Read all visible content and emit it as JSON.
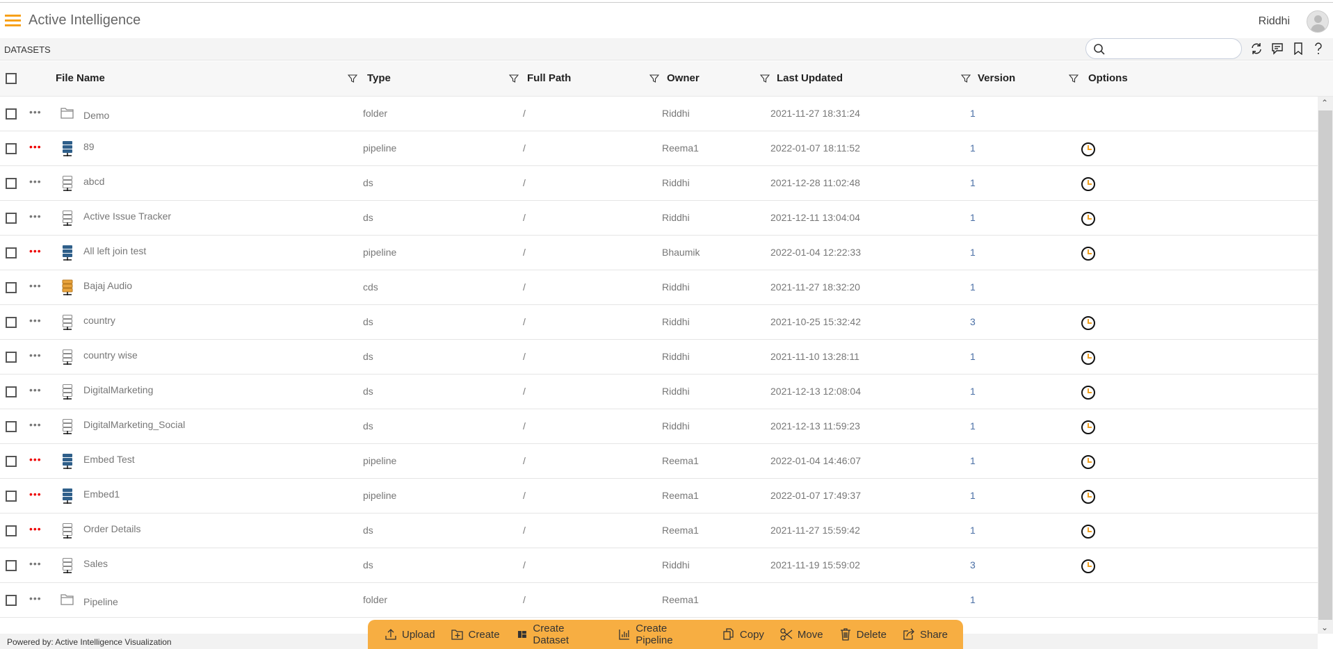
{
  "app": {
    "title": "Active Intelligence",
    "user": "Riddhi"
  },
  "section": {
    "title": "DATASETS",
    "search_placeholder": ""
  },
  "columns": [
    "File Name",
    "Type",
    "Full Path",
    "Owner",
    "Last Updated",
    "Version",
    "Options"
  ],
  "rows": [
    {
      "name": "Demo",
      "icon": "folder",
      "type": "folder",
      "path": "/",
      "owner": "Riddhi",
      "updated": "2021-11-27 18:31:24",
      "version": "1",
      "clock": false,
      "dots_red": false
    },
    {
      "name": "89",
      "icon": "pipeline",
      "type": "pipeline",
      "path": "/",
      "owner": "Reema1",
      "updated": "2022-01-07 18:11:52",
      "version": "1",
      "clock": true,
      "dots_red": true
    },
    {
      "name": "abcd",
      "icon": "ds",
      "type": "ds",
      "path": "/",
      "owner": "Riddhi",
      "updated": "2021-12-28 11:02:48",
      "version": "1",
      "clock": true,
      "dots_red": false
    },
    {
      "name": "Active Issue Tracker",
      "icon": "ds",
      "type": "ds",
      "path": "/",
      "owner": "Riddhi",
      "updated": "2021-12-11 13:04:04",
      "version": "1",
      "clock": true,
      "dots_red": false
    },
    {
      "name": "All left join test",
      "icon": "pipeline",
      "type": "pipeline",
      "path": "/",
      "owner": "Bhaumik",
      "updated": "2022-01-04 12:22:33",
      "version": "1",
      "clock": true,
      "dots_red": true
    },
    {
      "name": "Bajaj Audio",
      "icon": "cds",
      "type": "cds",
      "path": "/",
      "owner": "Riddhi",
      "updated": "2021-11-27 18:32:20",
      "version": "1",
      "clock": false,
      "dots_red": false
    },
    {
      "name": "country",
      "icon": "ds",
      "type": "ds",
      "path": "/",
      "owner": "Riddhi",
      "updated": "2021-10-25 15:32:42",
      "version": "3",
      "clock": true,
      "dots_red": false
    },
    {
      "name": "country wise",
      "icon": "ds",
      "type": "ds",
      "path": "/",
      "owner": "Riddhi",
      "updated": "2021-11-10 13:28:11",
      "version": "1",
      "clock": true,
      "dots_red": false
    },
    {
      "name": "DigitalMarketing",
      "icon": "ds",
      "type": "ds",
      "path": "/",
      "owner": "Riddhi",
      "updated": "2021-12-13 12:08:04",
      "version": "1",
      "clock": true,
      "dots_red": false
    },
    {
      "name": "DigitalMarketing_Social",
      "icon": "ds",
      "type": "ds",
      "path": "/",
      "owner": "Riddhi",
      "updated": "2021-12-13 11:59:23",
      "version": "1",
      "clock": true,
      "dots_red": false
    },
    {
      "name": "Embed Test",
      "icon": "pipeline",
      "type": "pipeline",
      "path": "/",
      "owner": "Reema1",
      "updated": "2022-01-04 14:46:07",
      "version": "1",
      "clock": true,
      "dots_red": true
    },
    {
      "name": "Embed1",
      "icon": "pipeline",
      "type": "pipeline",
      "path": "/",
      "owner": "Reema1",
      "updated": "2022-01-07 17:49:37",
      "version": "1",
      "clock": true,
      "dots_red": true
    },
    {
      "name": "Order Details",
      "icon": "ds",
      "type": "ds",
      "path": "/",
      "owner": "Reema1",
      "updated": "2021-11-27 15:59:42",
      "version": "1",
      "clock": true,
      "dots_red": true
    },
    {
      "name": "Sales",
      "icon": "ds",
      "type": "ds",
      "path": "/",
      "owner": "Riddhi",
      "updated": "2021-11-19 15:59:02",
      "version": "3",
      "clock": true,
      "dots_red": false
    },
    {
      "name": "Pipeline",
      "icon": "folder",
      "type": "folder",
      "path": "/",
      "owner": "Reema1",
      "updated": "",
      "version": "1",
      "clock": false,
      "dots_red": false
    }
  ],
  "toolbar": [
    "Upload",
    "Create",
    "Create Dataset",
    "Create Pipeline",
    "Copy",
    "Move",
    "Delete",
    "Share"
  ],
  "footer": "Powered by: Active Intelligence Visualization",
  "colors": {
    "accent": "#f7a11a",
    "toolbar": "#f7ae42",
    "pipeline": "#2f5f8a",
    "cds": "#e8a33c",
    "red_dots": "#e00000"
  }
}
